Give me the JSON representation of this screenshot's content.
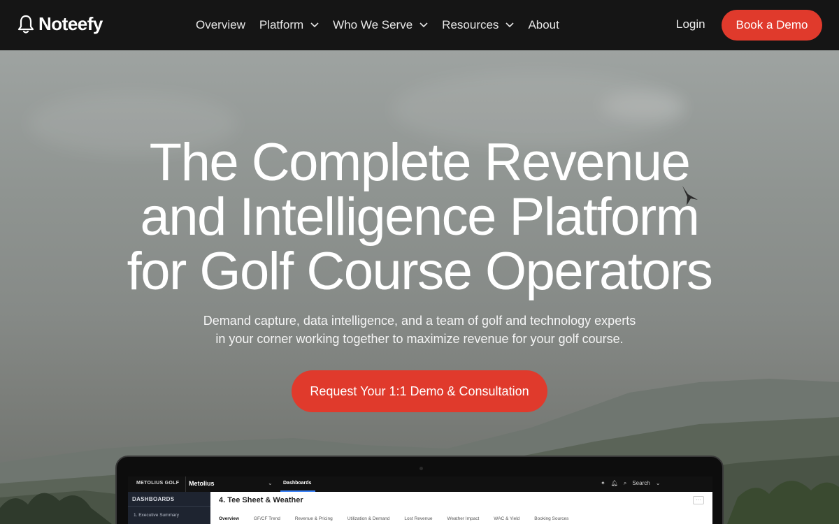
{
  "nav": {
    "brand": "Noteefy",
    "links": [
      {
        "label": "Overview",
        "has_dropdown": false
      },
      {
        "label": "Platform",
        "has_dropdown": true
      },
      {
        "label": "Who We Serve",
        "has_dropdown": true
      },
      {
        "label": "Resources",
        "has_dropdown": true
      },
      {
        "label": "About",
        "has_dropdown": false
      }
    ],
    "login_label": "Login",
    "demo_label": "Book a Demo"
  },
  "hero": {
    "headline_lines": [
      "The Complete Revenue",
      "and Intelligence Platform",
      "for Golf Course Operators"
    ],
    "subtitle_lines": [
      "Demand capture, data intelligence, and a team of golf and technology experts",
      "in your corner working together to maximize revenue for your golf course."
    ],
    "cta_label": "Request Your 1:1 Demo & Consultation"
  },
  "mockup": {
    "brand": "METOLIUS GOLF",
    "property": "Metolius",
    "section_tab": "Dashboards",
    "search_label": "Search",
    "sidebar_heading": "DASHBOARDS",
    "sidebar_item": "1. Executive Summary",
    "page_title": "4. Tee Sheet & Weather",
    "tabs": [
      "Overview",
      "GF/CF Trend",
      "Revenue & Pricing",
      "Utilization & Demand",
      "Lost Revenue",
      "Weather Impact",
      "WAC & Yield",
      "Booking Sources"
    ]
  },
  "colors": {
    "accent": "#e03a2c",
    "nav_bg": "#151515",
    "text_light": "#ffffff"
  }
}
